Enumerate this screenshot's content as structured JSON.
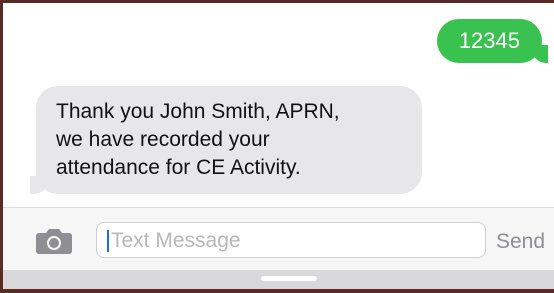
{
  "thread": {
    "sent_message": "12345",
    "received_message_lines": [
      "Thank you John Smith, APRN,",
      "we have recorded your",
      "attendance for CE Activity."
    ]
  },
  "input_bar": {
    "camera_icon": "camera-icon",
    "placeholder": "Text Message",
    "send_label": "Send"
  },
  "colors": {
    "sent_bubble": "#39c24f",
    "received_bubble": "#e7e7ea",
    "caret": "#1a6fe3"
  }
}
